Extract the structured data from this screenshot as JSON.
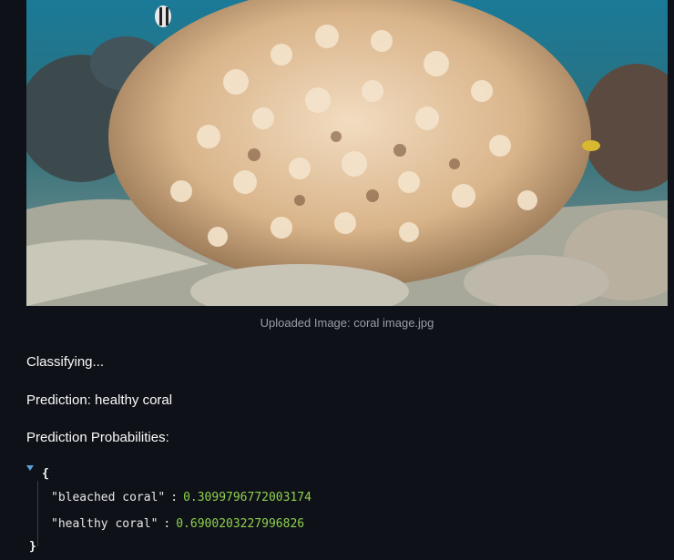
{
  "image": {
    "alt": "coral image.jpg"
  },
  "caption": "Uploaded Image: coral image.jpg",
  "messages": {
    "classifying": "Classifying...",
    "prediction": "Prediction: healthy coral",
    "probabilities_title": "Prediction Probabilities:"
  },
  "json_view": {
    "open_brace": "{",
    "close_brace": "}",
    "entries": [
      {
        "key": "\"bleached coral\"",
        "value": "0.3099796772003174"
      },
      {
        "key": "\"healthy coral\"",
        "value": "0.6900203227996826"
      }
    ]
  },
  "colors": {
    "background": "#0e1117",
    "number": "#8fd14f",
    "toggle": "#5aa0d8"
  }
}
